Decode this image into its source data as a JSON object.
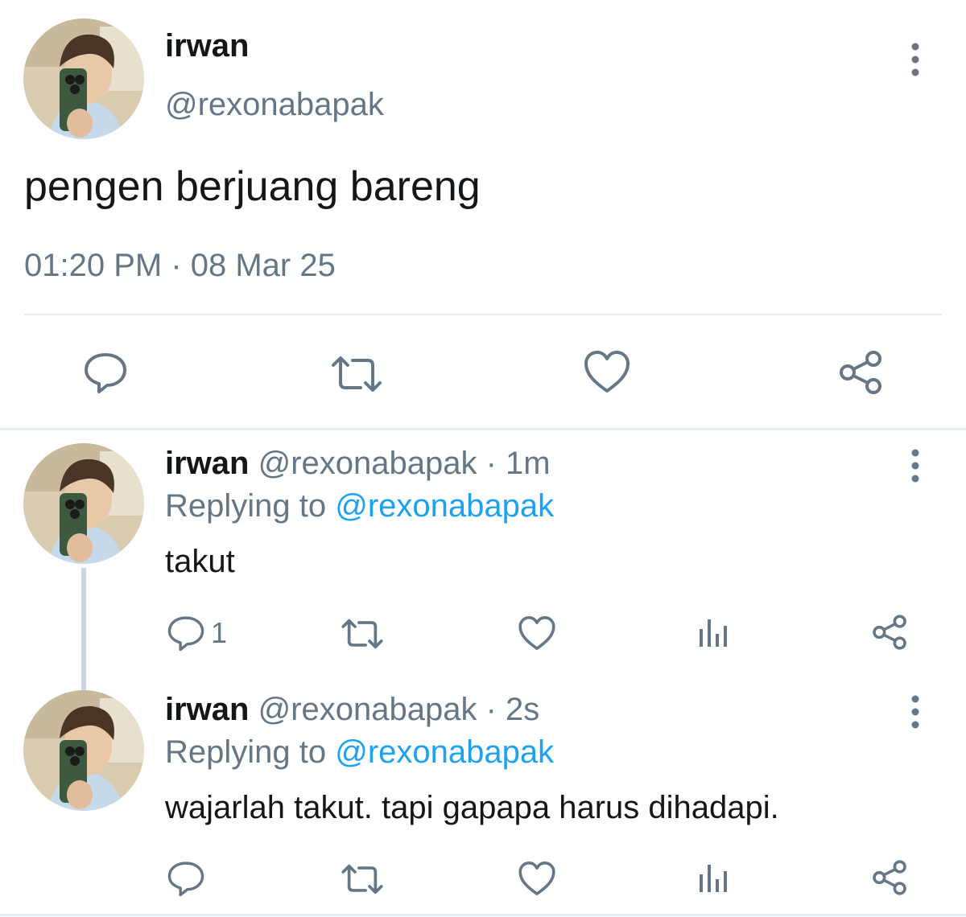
{
  "main_tweet": {
    "display_name": "irwan",
    "handle": "@rexonabapak",
    "text": "pengen berjuang bareng",
    "timestamp": "01:20 PM · 08 Mar 25",
    "actions": [
      "reply-icon",
      "retweet-icon",
      "like-icon",
      "share-icon"
    ]
  },
  "replies": [
    {
      "display_name": "irwan",
      "meta": "@rexonabapak · 1m",
      "replying_prefix": "Replying to",
      "replying_handle": "@rexonabapak",
      "text": "takut",
      "reply_count": "1"
    },
    {
      "display_name": "irwan",
      "meta": "@rexonabapak · 2s",
      "replying_prefix": "Replying to",
      "replying_handle": "@rexonabapak",
      "text": "wajarlah takut. tapi gapapa harus dihadapi.",
      "reply_count": ""
    }
  ],
  "colors": {
    "text": "#14171a",
    "muted": "#657786",
    "link": "#1da1f2",
    "divider": "#e6ecf0"
  }
}
